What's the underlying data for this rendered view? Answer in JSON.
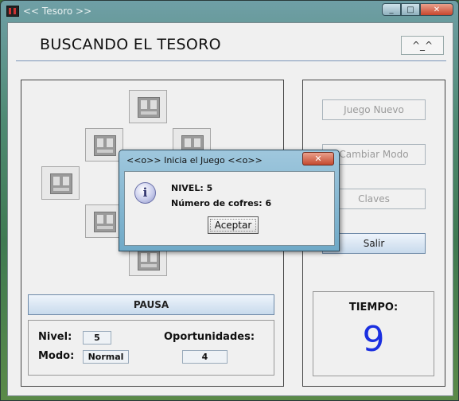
{
  "window": {
    "title": "<< Tesoro >>",
    "controls": {
      "minimize": "_",
      "maximize": "□",
      "close": "✕"
    }
  },
  "header": {
    "title": "BUSCANDO EL TESORO",
    "face_button": "^_^"
  },
  "board": {
    "chest_icon": "treasure-chest-icon"
  },
  "controls": {
    "pause_label": "PAUSA"
  },
  "stats": {
    "level_label": "Nivel:",
    "level_value": "5",
    "mode_label": "Modo:",
    "mode_value": "Normal",
    "chances_label": "Oportunidades:",
    "chances_value": "4"
  },
  "sidebar": {
    "new_game": "Juego Nuevo",
    "change_mode": "Cambiar Modo",
    "keys": "Claves",
    "exit": "Salir"
  },
  "timer": {
    "label": "TIEMPO:",
    "value": "9"
  },
  "dialog": {
    "title": "<<o>> Inicia el Juego <<o>>",
    "close": "✕",
    "info_icon": "i",
    "line1": "NIVEL: 5",
    "line2": "Número de cofres: 6",
    "ok": "Aceptar"
  },
  "colors": {
    "timer": "#1a2fe0",
    "accent": "#6e8aa8"
  }
}
